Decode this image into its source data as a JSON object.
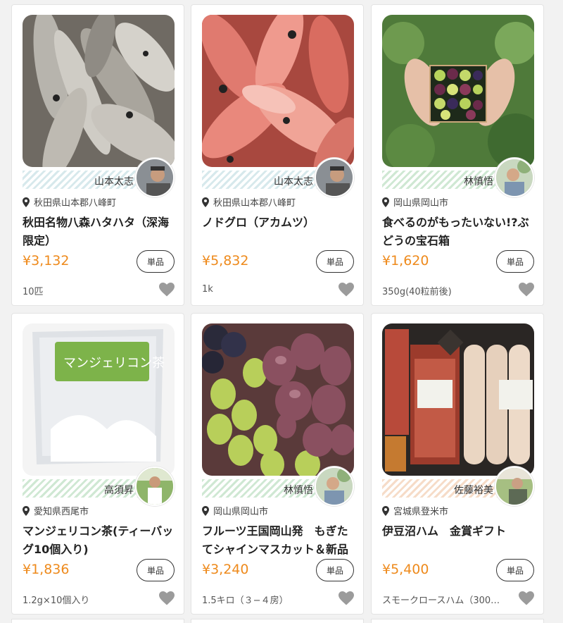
{
  "products": [
    {
      "image_icon": "fish-hatahata-photo",
      "producer": "山本太志",
      "location": "秋田県山本郡八峰町",
      "title": "秋田名物八森ハタハタ（深海限定）",
      "price": "¥3,132",
      "unit": "単品",
      "quantity": "10匹",
      "stripe": "blue"
    },
    {
      "image_icon": "fish-nodoguro-photo",
      "producer": "山本太志",
      "location": "秋田県山本郡八峰町",
      "title": "ノドグロ（アカムツ）",
      "price": "¥5,832",
      "unit": "単品",
      "quantity": "1k",
      "stripe": "blue"
    },
    {
      "image_icon": "grape-box-photo",
      "producer": "林慎悟",
      "location": "岡山県岡山市",
      "title": "食べるのがもったいない!?ぶどうの宝石箱",
      "price": "¥1,620",
      "unit": "単品",
      "quantity": "350g(40粒前後)",
      "stripe": "green"
    },
    {
      "image_icon": "tea-bag-photo",
      "producer": "高須昇",
      "location": "愛知県西尾市",
      "title": "マンジェリコン茶(ティーバッグ10個入り)",
      "price": "¥1,836",
      "unit": "単品",
      "quantity": "1.2g×10個入り",
      "stripe": "green"
    },
    {
      "image_icon": "grapes-photo",
      "producer": "林慎悟",
      "location": "岡山県岡山市",
      "title": "フルーツ王国岡山発　もぎたてシャインマスカット＆新品",
      "price": "¥3,240",
      "unit": "単品",
      "quantity": "1.5キロ（３−４房）",
      "stripe": "green"
    },
    {
      "image_icon": "ham-gift-photo",
      "producer": "佐藤裕美",
      "location": "宮城県登米市",
      "title": "伊豆沼ハム　金賞ギフト",
      "price": "¥5,400",
      "unit": "単品",
      "quantity": "スモークロースハム（300…",
      "stripe": "orange"
    }
  ],
  "icons": {
    "location": "map-pin-icon",
    "favorite": "heart-icon"
  },
  "colors": {
    "price": "#ee8a1c",
    "heart": "#9b9b9b"
  }
}
